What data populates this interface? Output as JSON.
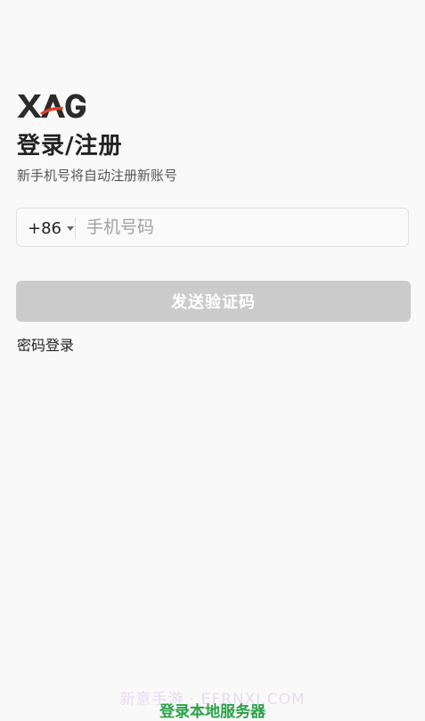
{
  "logo": {
    "text": "XAG",
    "colors": {
      "dark": "#2b2b2b",
      "accent": "#e23d2a"
    }
  },
  "header": {
    "title": "登录/注册",
    "subtitle": "新手机号将自动注册新账号"
  },
  "phone": {
    "country_code": "+86",
    "placeholder": "手机号码",
    "value": ""
  },
  "actions": {
    "send_code_label": "发送验证码",
    "password_login_label": "密码登录",
    "local_server_label": "登录本地服务器"
  },
  "watermark": "新意手游 · EFRNXI.COM",
  "colors": {
    "background": "#f9f9f9",
    "button_disabled": "#cbcbcb",
    "link_green": "#2ba14a"
  },
  "icons": {
    "dropdown": "caret-down-icon"
  }
}
